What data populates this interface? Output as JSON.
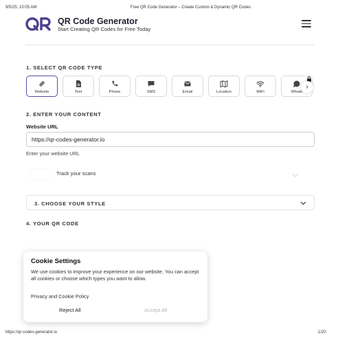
{
  "print": {
    "date": "9/5/25, 10:05 AM",
    "title": "Free QR Code Generator – Create Custom & Dynamic QR Codes",
    "url": "https://qr-codes-generator.io",
    "page": "1/20"
  },
  "header": {
    "title": "QR Code Generator",
    "subtitle": "Start Creating QR Codes for Free Today"
  },
  "section1": {
    "heading": "1. SELECT QR CODE TYPE",
    "types": [
      {
        "label": "Website",
        "icon": "link-icon",
        "active": true
      },
      {
        "label": "Text",
        "icon": "document-icon"
      },
      {
        "label": "Phone",
        "icon": "phone-icon"
      },
      {
        "label": "SMS",
        "icon": "message-icon"
      },
      {
        "label": "Email",
        "icon": "mail-icon"
      },
      {
        "label": "Location",
        "icon": "map-icon"
      },
      {
        "label": "WiFi",
        "icon": "wifi-icon"
      },
      {
        "label": "Whats",
        "icon": "whatsapp-icon"
      }
    ]
  },
  "section2": {
    "heading": "2. ENTER YOUR CONTENT",
    "field_label": "Website URL",
    "url_value": "https://qr-codes-generator.io",
    "help": "Enter your website URL",
    "track_label": "Track your scans"
  },
  "section3": {
    "heading": "3. CHOOSE YOUR STYLE"
  },
  "section4": {
    "heading": "4. YOUR QR CODE"
  },
  "cookie": {
    "title": "Cookie Settings",
    "body": "We use cookies to improve your experience on our website. You can accept all cookies or choose which types you want to allow.",
    "policy_link": "Privacy and Cookie Policy",
    "reject": "Reject All",
    "accept": "Accept All"
  },
  "colors": {
    "brand": "#4a3f8f",
    "active_border": "#5b4aa8"
  }
}
